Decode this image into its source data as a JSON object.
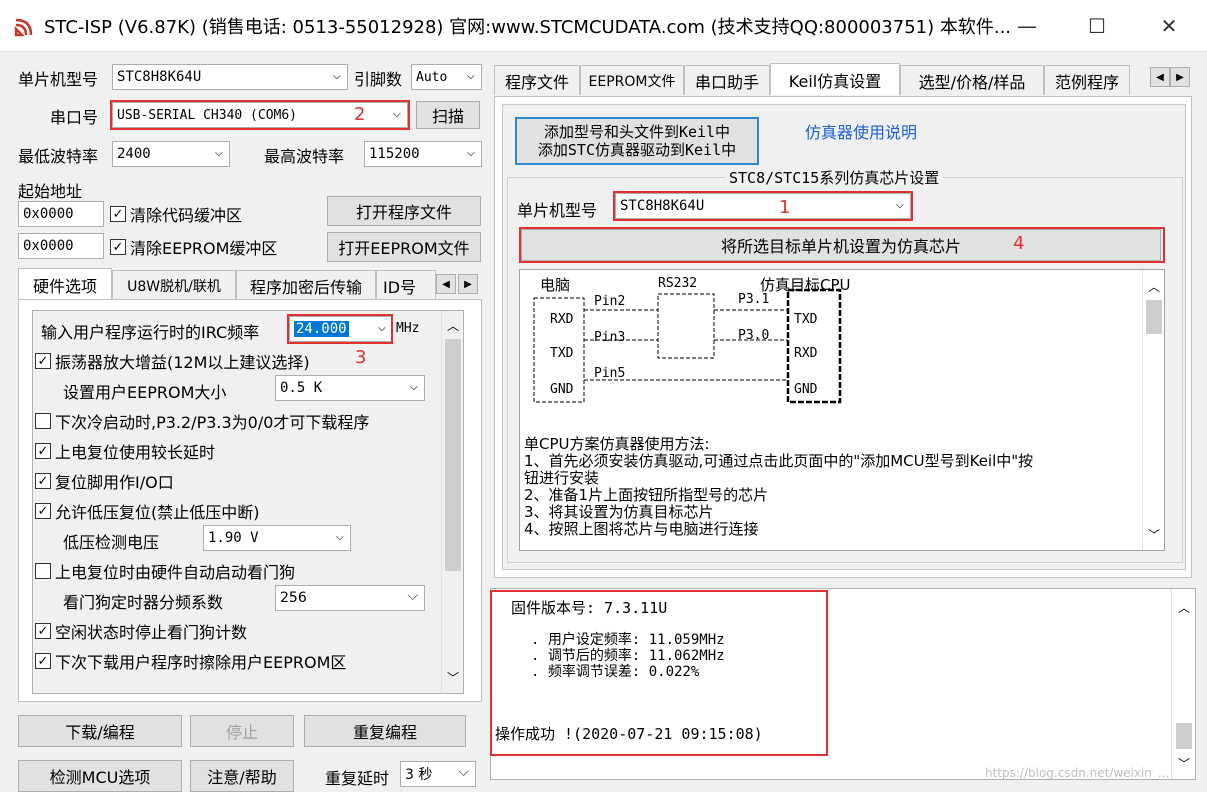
{
  "window": {
    "title": "STC-ISP (V6.87K) (销售电话: 0513-55012928) 官网:www.STCMCUDATA.com  (技术支持QQ:800003751) 本软件...",
    "minimize": "—",
    "maximize": "☐",
    "close": "✕"
  },
  "left": {
    "mcu_type_label": "单片机型号",
    "mcu_type_value": "STC8H8K64U",
    "pins_label": "引脚数",
    "pins_value": "Auto",
    "port_label": "串口号",
    "port_value": "USB-SERIAL CH340 (COM6)",
    "scan": "扫描",
    "min_baud_label": "最低波特率",
    "min_baud_value": "2400",
    "max_baud_label": "最高波特率",
    "max_baud_value": "115200",
    "start_addr_label": "起始地址",
    "addr1": "0x0000",
    "clear_code": "清除代码缓冲区",
    "open_program": "打开程序文件",
    "addr2": "0x0000",
    "clear_eeprom": "清除EEPROM缓冲区",
    "open_eeprom": "打开EEPROM文件",
    "tabs": [
      "硬件选项",
      "U8W脱机/联机",
      "程序加密后传输",
      "ID号"
    ],
    "irc_label": "输入用户程序运行时的IRC频率",
    "irc_value": "24.000",
    "irc_unit": "MHz",
    "opt_amp": "振荡器放大增益(12M以上建议选择)",
    "eeprom_size_label": "设置用户EEPROM大小",
    "eeprom_size_value": "0.5 K",
    "opt_cold": "下次冷启动时,P3.2/P3.3为0/0才可下载程序",
    "opt_delay": "上电复位使用较长延时",
    "opt_reset": "复位脚用作I/O口",
    "opt_lowv": "允许低压复位(禁止低压中断)",
    "lowv_label": "低压检测电压",
    "lowv_value": "1.90 V",
    "opt_wdt": "上电复位时由硬件自动启动看门狗",
    "wdt_div_label": "看门狗定时器分频系数",
    "wdt_div_value": "256",
    "opt_idle": "空闲状态时停止看门狗计数",
    "opt_erase": "下次下载用户程序时擦除用户EEPROM区",
    "download": "下载/编程",
    "stop": "停止",
    "reprogram": "重复编程",
    "check_mcu": "检测MCU选项",
    "help": "注意/帮助",
    "repeat_delay_label": "重复延时",
    "repeat_delay_value": "3 秒"
  },
  "right": {
    "tabs": [
      "程序文件",
      "EEPROM文件",
      "串口助手",
      "Keil仿真设置",
      "选型/价格/样品",
      "范例程序"
    ],
    "add_keil_line1": "添加型号和头文件到Keil中",
    "add_keil_line2": "添加STC仿真器驱动到Keil中",
    "emu_help": "仿真器使用说明",
    "group_title": "STC8/STC15系列仿真芯片设置",
    "mcu_label": "单片机型号",
    "mcu_value": "STC8H8K64U",
    "set_emu": "将所选目标单片机设置为仿真芯片",
    "diagram": {
      "pc": "电脑",
      "rs232": "RS232",
      "target": "仿真目标CPU",
      "rxd": "RXD",
      "txd": "TXD",
      "gnd": "GND",
      "pin2": "Pin2",
      "pin3": "Pin3",
      "pin5": "Pin5",
      "p31": "P3.1",
      "p30": "P3.0"
    },
    "instructions": [
      "单CPU方案仿真器使用方法:",
      "1、首先必须安装仿真驱动,可通过点击此页面中的\"添加MCU型号到Keil中\"按",
      "钮进行安装",
      "2、准备1片上面按钮所指型号的芯片",
      "3、将其设置为仿真目标芯片",
      "4、按照上图将芯片与电脑进行连接"
    ]
  },
  "log": {
    "firmware": "固件版本号: 7.3.11U",
    "user_freq": ". 用户设定频率: 11.059MHz",
    "adj_freq": ". 调节后的频率: 11.062MHz",
    "freq_err": ". 频率调节误差: 0.022%",
    "success": "操作成功 !(2020-07-21 09:15:08)"
  },
  "annotations": {
    "n1": "1",
    "n2": "2",
    "n3": "3",
    "n4": "4"
  },
  "watermark": "https://blog.csdn.net/weixin_..."
}
